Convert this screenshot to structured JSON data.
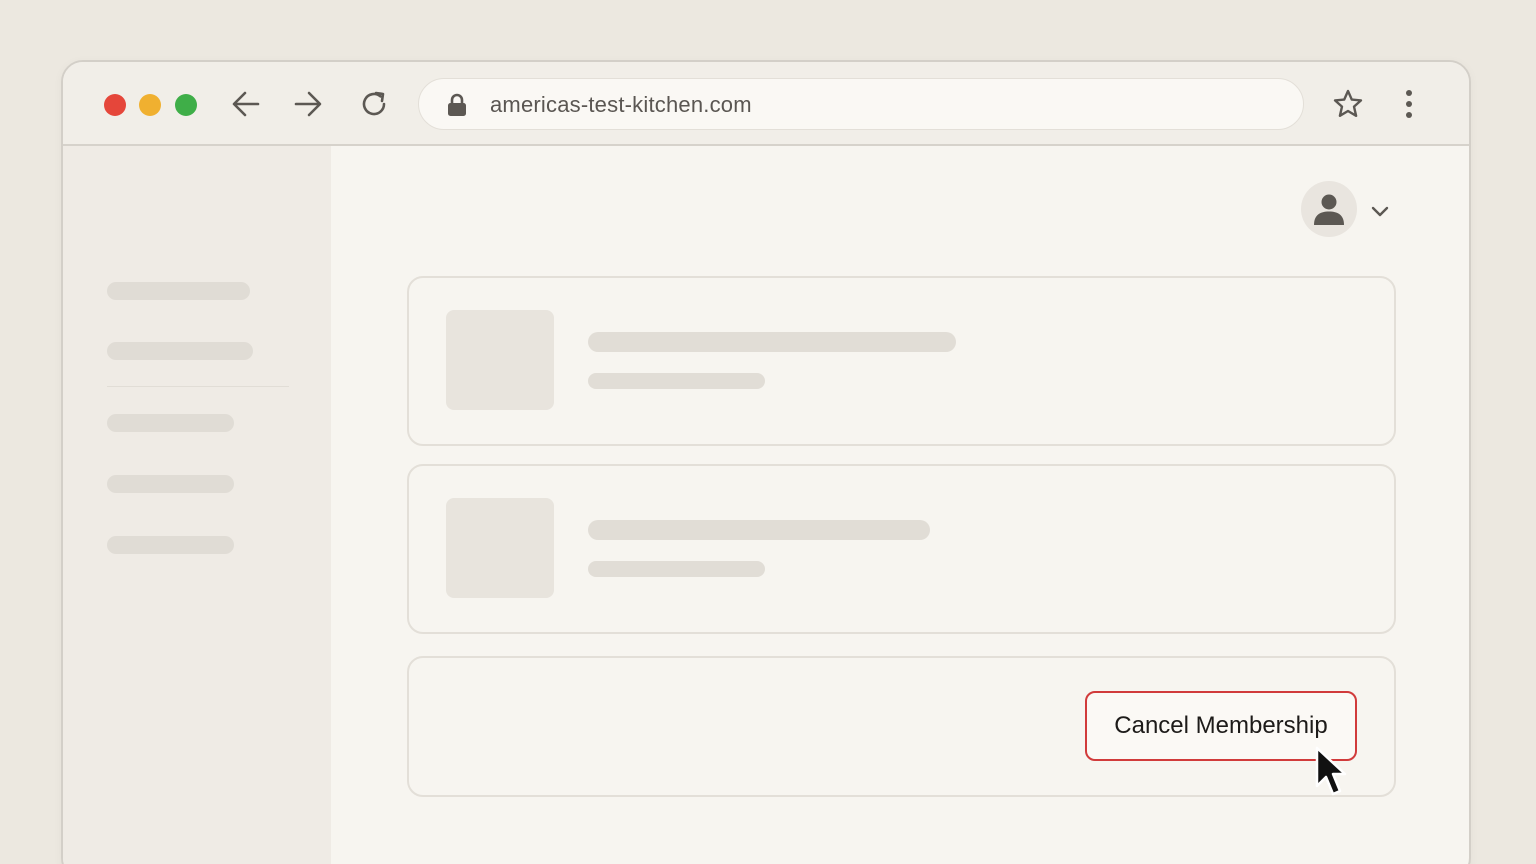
{
  "browser": {
    "url": "americas-test-kitchen.com",
    "traffic_lights": {
      "close": "#e5463a",
      "minimize": "#f0b030",
      "maximize": "#3fae48"
    },
    "icons": {
      "back": "arrow-left-icon",
      "forward": "arrow-right-icon",
      "reload": "reload-icon",
      "lock": "lock-icon",
      "bookmark": "star-icon",
      "menu": "kebab-menu-icon"
    }
  },
  "header": {
    "avatar_icon": "user-icon",
    "chevron_icon": "chevron-down-icon"
  },
  "membership": {
    "cancel_label": "Cancel Membership",
    "accent_color": "#d13b3b"
  }
}
